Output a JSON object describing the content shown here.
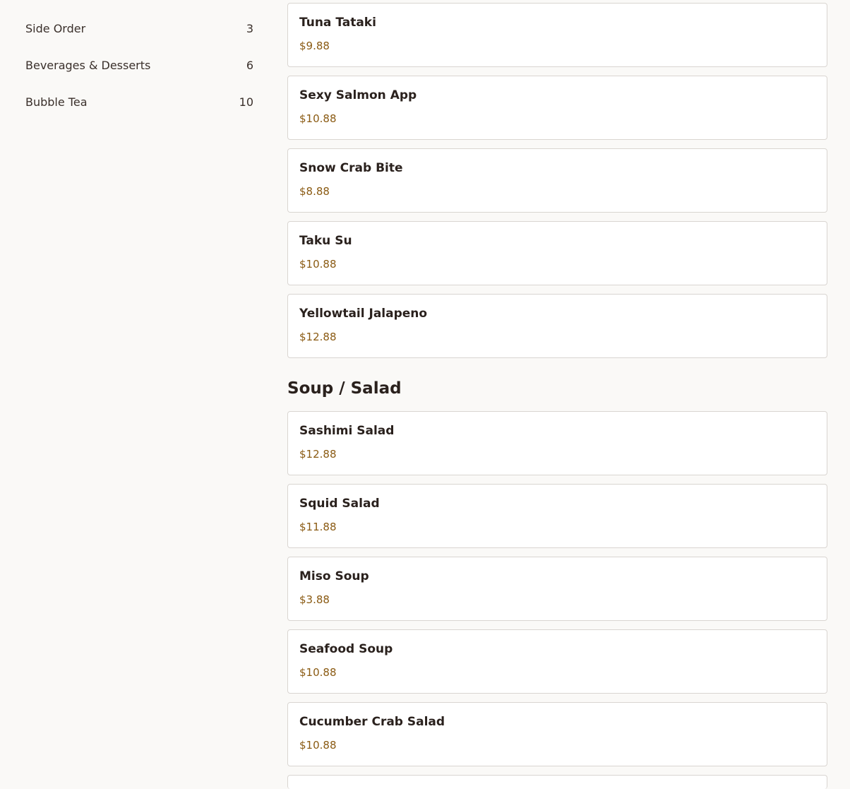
{
  "sidebar": {
    "categories": [
      {
        "label": "Side Order",
        "count": "3"
      },
      {
        "label": "Beverages & Desserts",
        "count": "6"
      },
      {
        "label": "Bubble Tea",
        "count": "10"
      }
    ]
  },
  "menu": {
    "top_items": [
      {
        "name": "Tuna Tataki",
        "price": "$9.88"
      },
      {
        "name": "Sexy Salmon App",
        "price": "$10.88"
      },
      {
        "name": "Snow Crab Bite",
        "price": "$8.88"
      },
      {
        "name": "Taku Su",
        "price": "$10.88"
      },
      {
        "name": "Yellowtail Jalapeno",
        "price": "$12.88"
      }
    ],
    "soup_salad": {
      "title": "Soup / Salad",
      "items": [
        {
          "name": "Sashimi Salad",
          "price": "$12.88"
        },
        {
          "name": "Squid Salad",
          "price": "$11.88"
        },
        {
          "name": "Miso Soup",
          "price": "$3.88"
        },
        {
          "name": "Seafood Soup",
          "price": "$10.88"
        },
        {
          "name": "Cucumber Crab Salad",
          "price": "$10.88"
        }
      ]
    }
  },
  "colors": {
    "background": "#faf9f7",
    "price": "#8a5a12",
    "border": "#d9d5d1"
  }
}
